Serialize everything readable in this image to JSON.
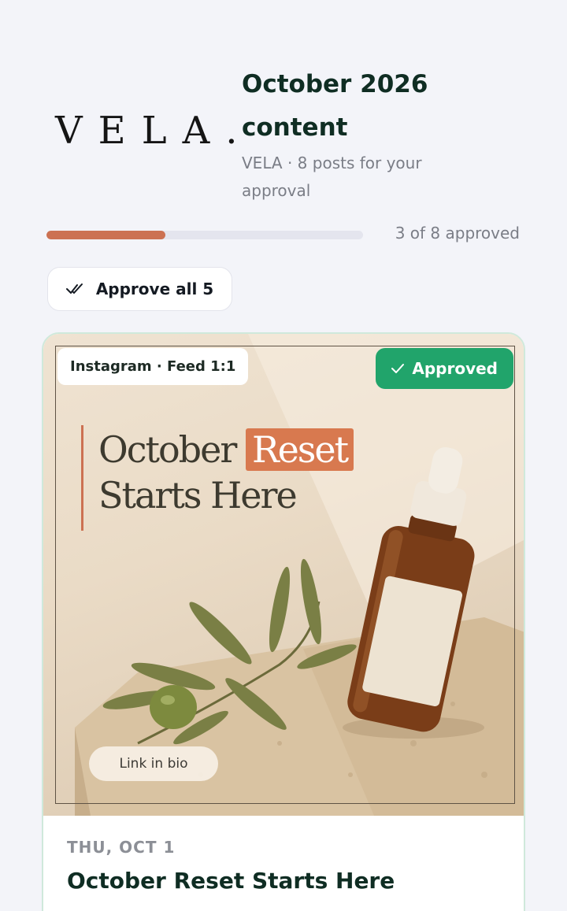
{
  "header": {
    "logo_text": "VELA.",
    "title": "October 2026 content",
    "subtitle": "VELA · 8 posts for your approval"
  },
  "progress": {
    "approved": 3,
    "total": 8,
    "fraction": 0.375,
    "label": "3 of 8 approved",
    "color": "#cc7152"
  },
  "actions": {
    "approve_all_label": "Approve all 5",
    "approve_all_icon": "double-check-icon"
  },
  "post": {
    "platform_label": "Instagram · Feed 1:1",
    "status_label": "Approved",
    "status_icon": "check-icon",
    "status_color": "#21a46b",
    "image": {
      "headline_part1": "October",
      "headline_accent": "Reset",
      "headline_line2": "Starts Here",
      "cta": "Link in bio"
    },
    "date": "THU, OCT 1",
    "title": "October Reset Starts Here"
  }
}
